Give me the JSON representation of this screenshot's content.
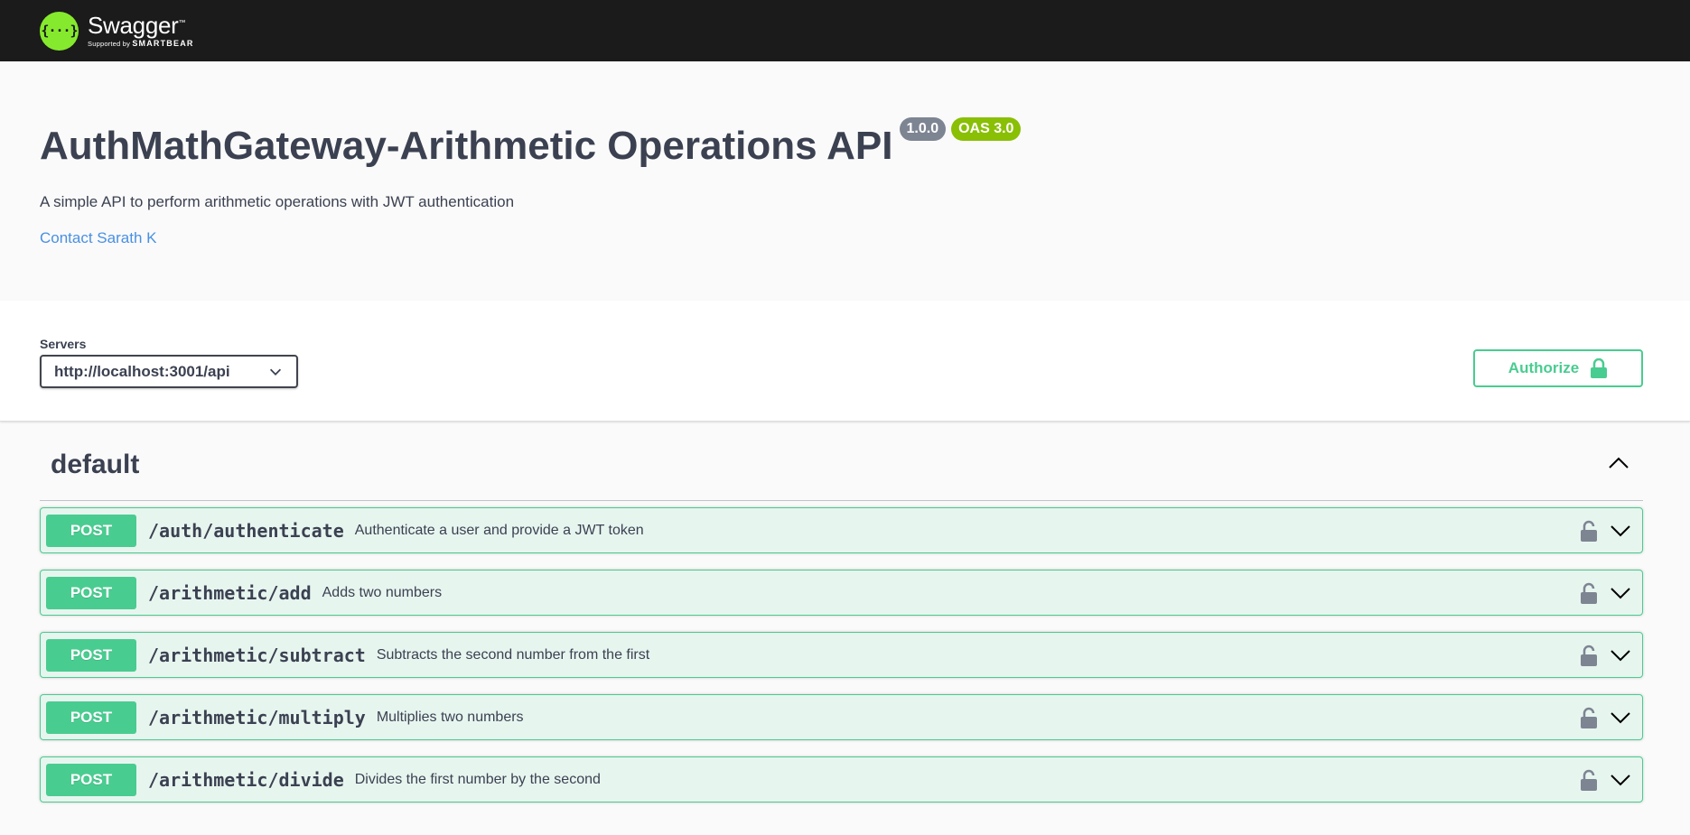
{
  "topbar": {
    "logo_symbol": "{···}",
    "logo_name": "Swagger",
    "logo_tm": "™",
    "logo_sub_prefix": "Supported by",
    "logo_sub_brand": "SMARTBEAR"
  },
  "info": {
    "title": "AuthMathGateway-Arithmetic Operations API",
    "version": "1.0.0",
    "oas": "OAS 3.0",
    "description": "A simple API to perform arithmetic operations with JWT authentication",
    "contact": "Contact Sarath K"
  },
  "servers": {
    "label": "Servers",
    "selected": "http://localhost:3001/api"
  },
  "authorize": {
    "label": "Authorize"
  },
  "tag": {
    "name": "default"
  },
  "operations": [
    {
      "method": "POST",
      "path": "/auth/authenticate",
      "summary": "Authenticate a user and provide a JWT token"
    },
    {
      "method": "POST",
      "path": "/arithmetic/add",
      "summary": "Adds two numbers"
    },
    {
      "method": "POST",
      "path": "/arithmetic/subtract",
      "summary": "Subtracts the second number from the first"
    },
    {
      "method": "POST",
      "path": "/arithmetic/multiply",
      "summary": "Multiplies two numbers"
    },
    {
      "method": "POST",
      "path": "/arithmetic/divide",
      "summary": "Divides the first number by the second"
    }
  ],
  "colors": {
    "topbar": "#1b1b1b",
    "post": "#49cc90",
    "logo": "#85ea2d",
    "link": "#4990e2"
  }
}
